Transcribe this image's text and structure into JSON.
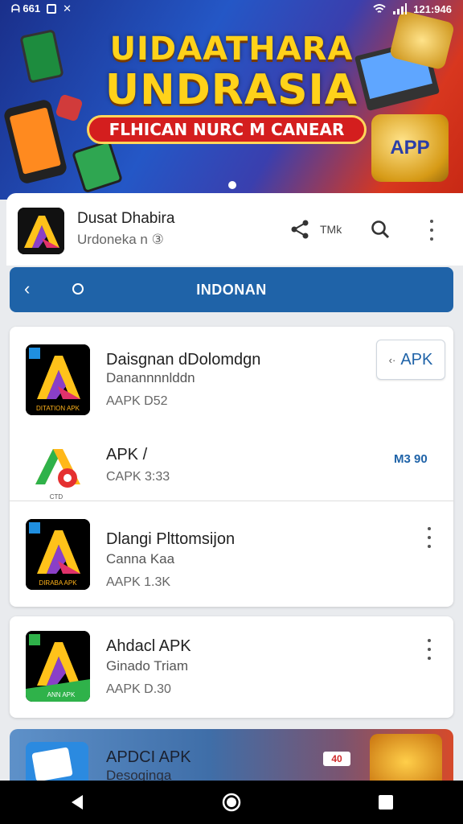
{
  "status_bar": {
    "left_text": "ᗩ 661",
    "time": "121:946"
  },
  "banner": {
    "title_line1": "UIDAATHARA",
    "title_line2": "UNDRASIA",
    "ribbon": "FLHICAN NURC M CANEAR",
    "jar_label": "APP",
    "active_slide": 1
  },
  "app_header": {
    "name": "Dusat Dhabira",
    "developer": "Urdoneka n ③",
    "share_label": "TMk"
  },
  "tab_bar": {
    "title": "INDONAN",
    "back_glyph": "‹"
  },
  "list": [
    {
      "title": "Daisgnan dDolomdgn",
      "subtitle": "Danannnnlddn",
      "meta": "AAPK D52",
      "action_label": "APK",
      "action_prefix": "‹·",
      "icon_caption": "DITATION APK"
    },
    {
      "title": "APK /",
      "subtitle": "",
      "meta": "CAPK 3:33",
      "badge": "M3 90",
      "icon_caption": "CTD"
    },
    {
      "title": "Dlangi Plttomsijon",
      "subtitle": "Canna Kaa",
      "meta": "AAPK 1.3K",
      "icon_caption": "DIRABA APK"
    },
    {
      "title": "Ahdacl APK",
      "subtitle": "Ginado Triam",
      "meta": "AAPK D.30",
      "icon_caption": "ANN APK"
    }
  ],
  "peek_item": {
    "title": "APDCI APK",
    "subtitle": "Desoginga",
    "tag": "40"
  },
  "colors": {
    "primary": "#1f63a8",
    "banner_yellow": "#ffd21a",
    "banner_red": "#d41e1e"
  }
}
